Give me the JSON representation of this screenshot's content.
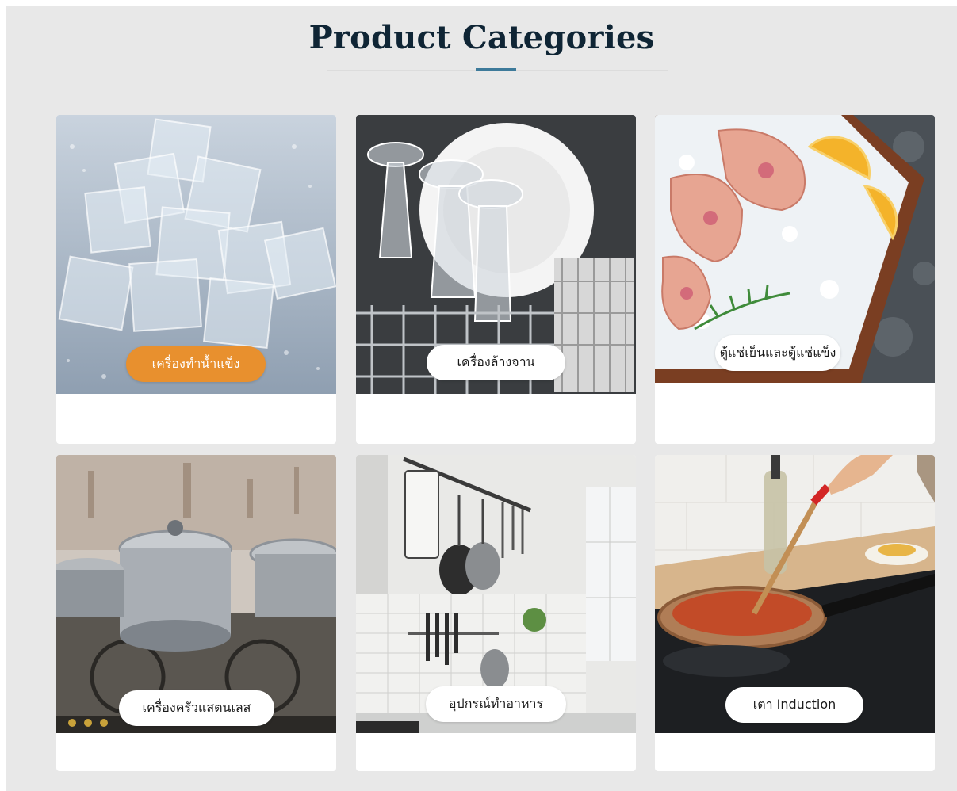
{
  "header": {
    "title": "Product Categories"
  },
  "categories": [
    {
      "label": "เครื่องทำน้ำแข็ง",
      "image": "ice-cubes",
      "active": true
    },
    {
      "label": "เครื่องล้างจาน",
      "image": "dishwasher-rack",
      "active": false
    },
    {
      "label": "ตู้แช่เย็นและตู้แช่แข็ง",
      "image": "salmon-on-ice",
      "active": false
    },
    {
      "label": "เครื่องครัวแสตนเลส",
      "image": "stainless-pots",
      "active": false
    },
    {
      "label": "อุปกรณ์ทำอาหาร",
      "image": "kitchen-utensils",
      "active": false
    },
    {
      "label": "เตา Induction",
      "image": "induction-pan",
      "active": false
    }
  ],
  "colors": {
    "accent": "#e8902e",
    "title": "#0f2535",
    "rule": "#3d7a9a",
    "background": "#e8e8e8"
  }
}
